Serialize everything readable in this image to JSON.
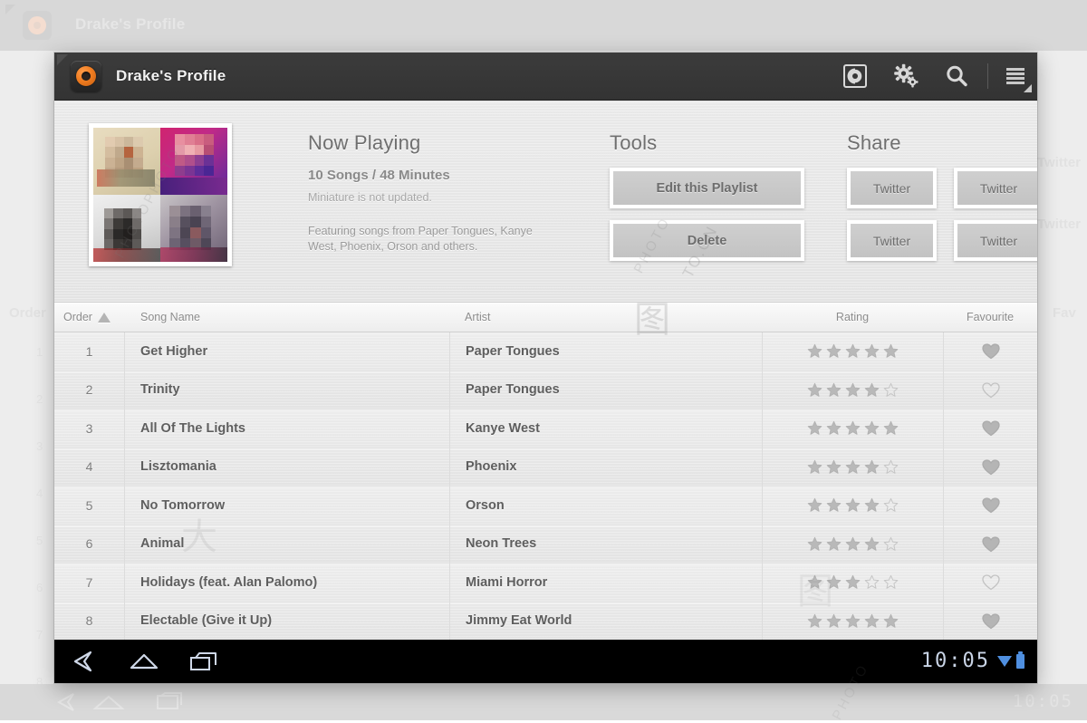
{
  "window": {
    "title": "Drake's Profile",
    "app_icon": "vinyl-disc-icon"
  },
  "actionbar": {
    "icons": [
      {
        "name": "disc-icon",
        "label": "Now Playing"
      },
      {
        "name": "settings-gear-icon",
        "label": "Settings"
      },
      {
        "name": "search-icon",
        "label": "Search"
      },
      {
        "name": "overflow-menu-icon",
        "label": "More options"
      }
    ]
  },
  "now_playing": {
    "heading": "Now Playing",
    "stats": "10 Songs / 48 Minutes",
    "note": "Miniature is not updated.",
    "featuring": "Featuring songs from Paper Tongues, Kanye West, Phoenix, Orson and others."
  },
  "tools": {
    "heading": "Tools",
    "buttons": [
      {
        "label": "Edit this Playlist",
        "name": "edit-playlist-button"
      },
      {
        "label": "Delete",
        "name": "delete-playlist-button"
      }
    ]
  },
  "share": {
    "heading": "Share",
    "buttons": [
      {
        "label": "Twitter",
        "name": "share-twitter-button-1"
      },
      {
        "label": "Twitter",
        "name": "share-twitter-button-2"
      },
      {
        "label": "Twitter",
        "name": "share-twitter-button-3"
      },
      {
        "label": "Twitter",
        "name": "share-twitter-button-4"
      }
    ]
  },
  "table": {
    "columns": [
      "Order",
      "Song Name",
      "Artist",
      "Rating",
      "Favourite"
    ],
    "sort_column": "Order",
    "sort_direction": "ascending",
    "max_rating": 5,
    "rows": [
      {
        "order": "1",
        "song": "Get Higher",
        "artist": "Paper Tongues",
        "rating": 5,
        "favourite": true
      },
      {
        "order": "2",
        "song": "Trinity",
        "artist": "Paper Tongues",
        "rating": 4,
        "favourite": false
      },
      {
        "order": "3",
        "song": "All Of The Lights",
        "artist": "Kanye West",
        "rating": 5,
        "favourite": true
      },
      {
        "order": "4",
        "song": "Lisztomania",
        "artist": "Phoenix",
        "rating": 4,
        "favourite": true
      },
      {
        "order": "5",
        "song": "No Tomorrow",
        "artist": "Orson",
        "rating": 4,
        "favourite": true
      },
      {
        "order": "6",
        "song": "Animal",
        "artist": "Neon Trees",
        "rating": 4,
        "favourite": true
      },
      {
        "order": "7",
        "song": "Holidays (feat. Alan Palomo)",
        "artist": "Miami Horror",
        "rating": 3,
        "favourite": false
      },
      {
        "order": "8",
        "song": "Electable (Give it Up)",
        "artist": "Jimmy Eat World",
        "rating": 5,
        "favourite": true
      }
    ]
  },
  "system_bar": {
    "back_icon": "back-icon",
    "home_icon": "home-icon",
    "recents_icon": "recent-apps-icon",
    "clock": "10:05",
    "wifi_icon": "wifi-icon",
    "battery_icon": "battery-icon"
  },
  "background_layer": {
    "title": "Drake's Profile",
    "order_header": "Order",
    "fav_header": "Fav",
    "share_labels": [
      "Twitter",
      "Twitter"
    ],
    "clock": "10:05",
    "row_numbers": [
      "1",
      "2",
      "3",
      "4",
      "5",
      "6",
      "7",
      "8"
    ]
  },
  "watermark": {
    "photophoto": "PHOTOPHOTO",
    "cn": "TO.CN",
    "photo": "PHOTO"
  },
  "colors": {
    "accent_orange": "#f07d21",
    "actionbar_dark": "#363636",
    "panel_bg": "#e7e7e7",
    "system_blue": "#4f8fe0"
  }
}
